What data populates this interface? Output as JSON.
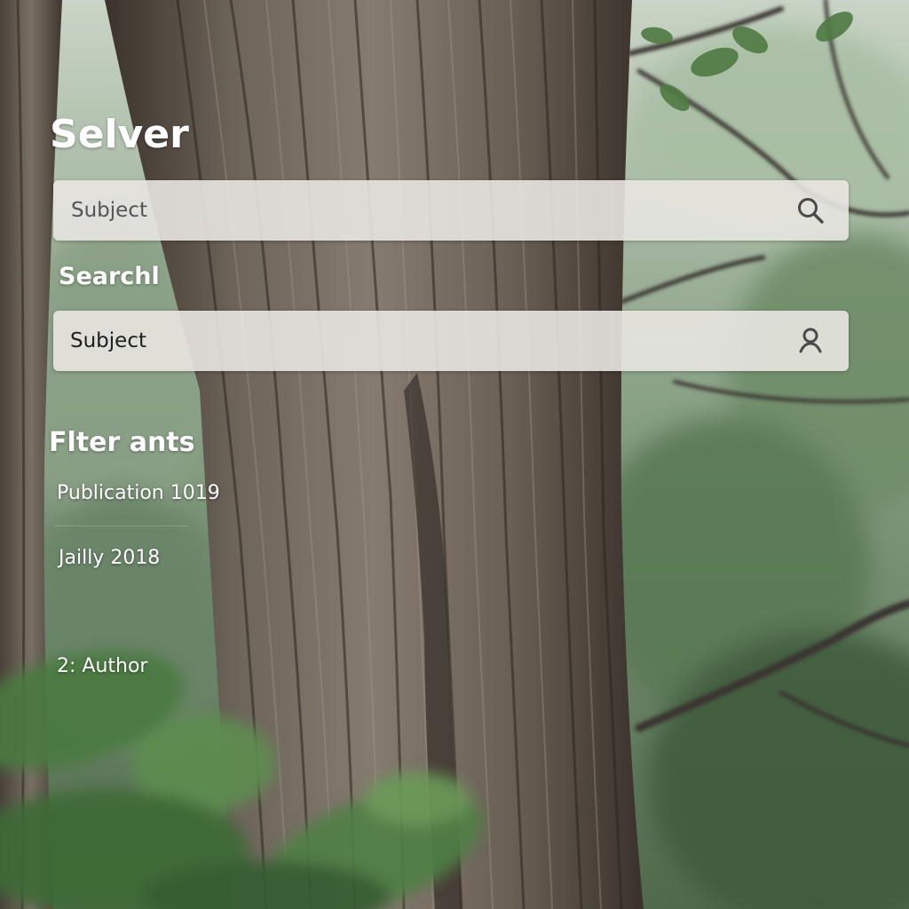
{
  "app": {
    "title": "Selver"
  },
  "search_bar_primary": {
    "placeholder": "Subject",
    "icon": "search-icon"
  },
  "search_section": {
    "heading": "Searchl"
  },
  "search_bar_secondary": {
    "placeholder": "Subject",
    "icon": "user-icon"
  },
  "filters": {
    "heading": "Flter ants",
    "items": [
      {
        "label": "Publication 1019"
      },
      {
        "label": "Jailly 2018"
      },
      {
        "label": "2: Author"
      }
    ]
  },
  "colors": {
    "text_light": "#ffffff",
    "bar_background": "#e8e5e1",
    "icon": "#4a4a4a"
  }
}
